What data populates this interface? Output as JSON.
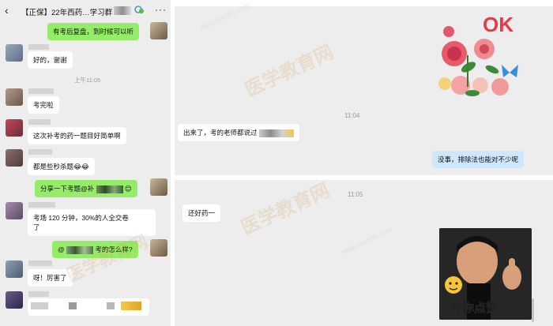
{
  "header": {
    "back_icon": "chevron-left-icon",
    "title": "【正保】22年西药…学习群",
    "more_label": "···"
  },
  "left_chat": {
    "messages": [
      {
        "side": "out",
        "text": "有考后复盘，到时候可以听"
      },
      {
        "side": "in",
        "text": "好的，谢谢"
      },
      {
        "type": "time",
        "text": "上午11:05"
      },
      {
        "side": "in",
        "text": "考完啦"
      },
      {
        "side": "in",
        "text": "这次补考的药一题目好简单啊"
      },
      {
        "side": "in",
        "text": "都是些秒杀题😂😂"
      },
      {
        "side": "out",
        "text_a": "分享一下考题@补",
        "text_b": "😊"
      },
      {
        "side": "in",
        "text_a": "考场 120 分钟，30%的人全交卷",
        "text_b": "了"
      },
      {
        "side": "out",
        "text_a": "@",
        "text_b": "考的怎么样?"
      },
      {
        "side": "in",
        "text": "呀！厉害了"
      }
    ]
  },
  "right_chat": {
    "sticker_ok": "OK",
    "time_1": "11:04",
    "msg_1": "出来了，考的老师都说过",
    "msg_2": "没事，排除法也能对不少呢",
    "time_2": "11:05",
    "msg_3": "还好药一",
    "sticker_praise": "为你点赞"
  },
  "watermark": {
    "text": "医学教育网",
    "url": "www.med66.com"
  },
  "colors": {
    "green_bubble": "#95ec69",
    "blue_bubble": "#cfe7fb",
    "background": "#ededed"
  }
}
